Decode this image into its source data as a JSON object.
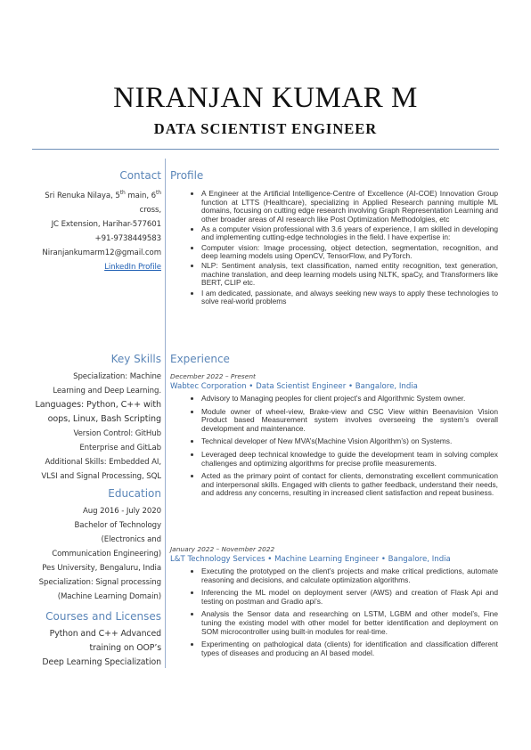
{
  "header": {
    "name": "NIRANJAN KUMAR M",
    "title": "DATA  SCIENTIST  ENGINEER"
  },
  "contact": {
    "heading": "Contact",
    "address_line1_a": "Sri Renuka Nilaya, 5",
    "address_line1_sup1": "th",
    "address_line1_b": " main, 6",
    "address_line1_sup2": "th",
    "address_line2": "cross,",
    "address_line3": "JC Extension, Harihar-577601",
    "phone": "+91-9738449583",
    "email": "Niranjankumarm12@gmail.com",
    "linkedin": "LinkedIn Profile"
  },
  "skills": {
    "heading": "Key Skills",
    "lines": [
      "Specialization: Machine",
      "Learning and Deep Learning.",
      "Languages: Python, C++ with",
      "oops, Linux, Bash Scripting",
      "Version Control: GitHub",
      "Enterprise and GitLab",
      "Additional Skills: Embedded AI,",
      "VLSI and Signal Processing, SQL"
    ]
  },
  "education": {
    "heading": "Education",
    "lines": [
      "Aug 2016 - July 2020",
      "Bachelor of Technology",
      "(Electronics and",
      "Communication Engineering)",
      "Pes University, Bengaluru, India",
      "Specialization: Signal processing",
      "(Machine Learning Domain)"
    ]
  },
  "courses": {
    "heading": "Courses and Licenses",
    "lines": [
      "Python and C++ Advanced",
      "training on OOP’s",
      "Deep Learning Specialization"
    ]
  },
  "profile": {
    "heading": "Profile",
    "bullets": [
      "A Engineer at the Artificial Intelligence-Centre of Excellence (AI-COE) Innovation Group function at LTTS (Healthcare), specializing in Applied Research panning multiple ML domains, focusing on cutting edge research involving Graph Representation Learning and other broader areas of AI research like Post Optimization Methodolgies, etc",
      "As a computer vision professional with 3.6 years of experience, I am skilled in developing and implementing cutting-edge technologies in the field. I have expertise in:",
      "Computer vision: Image processing, object detection, segmentation, recognition, and deep learning models using OpenCV, TensorFlow, and PyTorch.",
      "NLP: Sentiment analysis, text classification, named entity recognition, text generation, machine translation, and deep learning models using NLTK, spaCy, and Transformers like BERT, CLIP etc.",
      "I am dedicated, passionate, and always seeking new ways to apply these technologies to solve real-world problems"
    ]
  },
  "experience": {
    "heading": "Experience",
    "jobs": [
      {
        "date": "December 2022 – Present",
        "role": "Wabtec Corporation • Data Scientist Engineer • Bangalore, India",
        "bullets": [
          "Advisory to Managing peoples for client project’s and Algorithmic System owner.",
          "Module owner of wheel-view, Brake-view and CSC View within Beenavision Vision Product based Measurement system involves overseeing the system’s overall development and maintenance.",
          "Technical developer of New MVA’s(Machine Vision Algorithm’s) on Systems.",
          "Leveraged deep technical knowledge to guide the development team in solving complex challenges and optimizing algorithms for precise profile measurements.",
          "Acted as the primary point of contact for clients, demonstrating excellent communication and interpersonal skills. Engaged with clients to gather feedback, understand their needs, and address any concerns, resulting in increased client satisfaction and repeat business."
        ]
      },
      {
        "date": "January 2022 – November 2022",
        "role": "L&T Technology Services • Machine Learning Engineer • Bangalore, India",
        "bullets": [
          "Executing the prototyped on the client’s projects and make critical predictions, automate reasoning and decisions, and calculate optimization algorithms.",
          "Inferencing the ML model on deployment server (AWS) and creation of Flask Api and testing on postman and Gradio api’s.",
          "Analysis the Sensor data and researching on LSTM, LGBM and other model’s, Fine tuning the existing model with other model for better identification and deployment on SOM microcontroller using built-in modules for real-time.",
          "Experimenting on pathological data (clients) for identification and classification different types of diseases and producing an AI based model."
        ]
      }
    ]
  }
}
